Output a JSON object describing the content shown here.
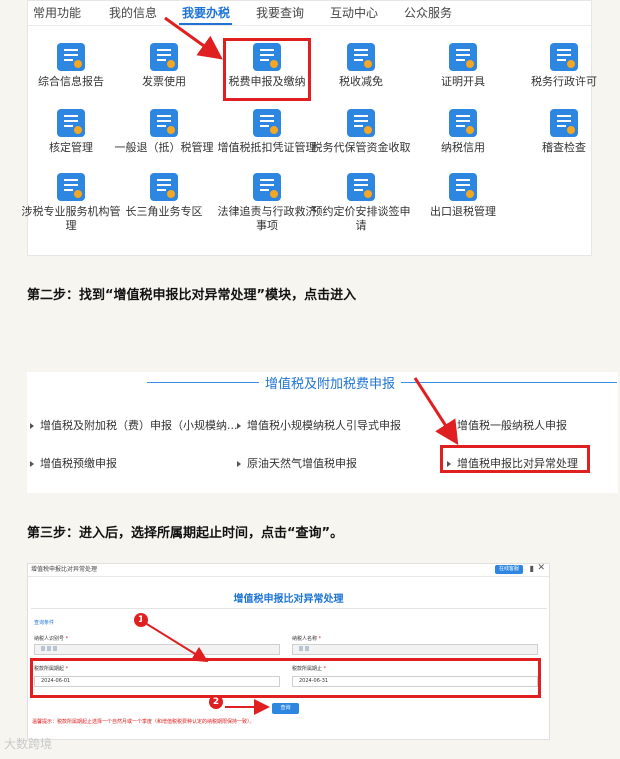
{
  "panel1": {
    "tabs": [
      "常用功能",
      "我的信息",
      "我要办税",
      "我要查询",
      "互动中心",
      "公众服务"
    ],
    "active_tab": "我要办税",
    "apps": [
      {
        "label": "综合信息报告",
        "icon": "report-icon"
      },
      {
        "label": "发票使用",
        "icon": "invoice-icon"
      },
      {
        "label": "税费申报及缴纳",
        "icon": "tax-declare-icon"
      },
      {
        "label": "税收减免",
        "icon": "tax-relief-icon"
      },
      {
        "label": "证明开具",
        "icon": "certificate-icon"
      },
      {
        "label": "税务行政许可",
        "icon": "license-icon"
      },
      {
        "label": "核定管理",
        "icon": "assess-icon"
      },
      {
        "label": "一般退（抵）税管理",
        "icon": "refund-icon"
      },
      {
        "label": "增值税抵扣凭证管理",
        "icon": "vat-voucher-icon"
      },
      {
        "label": "税务代保管资金收取",
        "icon": "custody-icon"
      },
      {
        "label": "纳税信用",
        "icon": "credit-icon"
      },
      {
        "label": "稽查检查",
        "icon": "inspection-icon"
      },
      {
        "label": "涉税专业服务机构管理",
        "icon": "agency-icon"
      },
      {
        "label": "长三角业务专区",
        "icon": "yangtze-icon"
      },
      {
        "label": "法律追责与行政救济事项",
        "icon": "legal-icon"
      },
      {
        "label": "预约定价安排谈签申请",
        "icon": "pricing-icon"
      },
      {
        "label": "出口退税管理",
        "icon": "export-refund-icon"
      }
    ]
  },
  "step2": "第二步：找到“增值税申报比对异常处理”模块，点击进入",
  "panel2": {
    "title": "增值税及附加税费申报",
    "items": [
      "增值税及附加税（费）申报（小规模纳...",
      "增值税小规模纳税人引导式申报",
      "增值税一般纳税人申报",
      "增值税预缴申报",
      "原油天然气增值税申报",
      "增值税申报比对异常处理"
    ]
  },
  "step3": "第三步：进入后，选择所属期起止时间，点击“查询”。",
  "panel3": {
    "window_title": "增值税申报比对异常处理",
    "online_btn": "在线客服",
    "heading": "增值税申报比对异常处理",
    "condition_label": "查询条件",
    "taxpayer_id_label": "纳税人识别号",
    "taxpayer_name_label": "纳税人名称",
    "period_start_label": "税款所属期起",
    "period_end_label": "税款所属期止",
    "period_start": "2024-06-01",
    "period_end": "2024-06-31",
    "query_btn": "查询",
    "tip": "温馨提示：税款所属期起止选择一个自然月或一个季度（和增值税税费种认定的纳税期限保持一致）。",
    "badge1": "1",
    "badge2": "2"
  },
  "watermark": "大数跨境",
  "colors": {
    "accent": "#1e74d6",
    "highlight": "#e02020",
    "icon": "#2d86e0"
  }
}
